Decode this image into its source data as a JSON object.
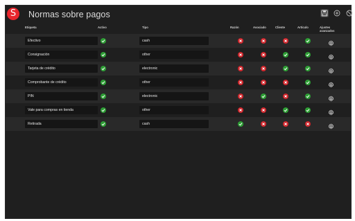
{
  "app": {
    "logo_letter": "S",
    "title": "Normas sobre pagos"
  },
  "toolbar": {
    "icons": [
      "save-icon",
      "add-icon",
      "block-icon"
    ]
  },
  "columns": {
    "label": "Etiqueta",
    "active": "Activo",
    "type": "Tipo",
    "reason": "Razón",
    "associated": "Asociado",
    "customer": "Cliente",
    "item": "Artículo",
    "advanced_1": "Ajustes",
    "advanced_2": "avanzados"
  },
  "rows": [
    {
      "label": "Efectivo",
      "active": true,
      "type": "cash",
      "reason": false,
      "associated": false,
      "customer": false,
      "item": true
    },
    {
      "label": "Consignación",
      "active": true,
      "type": "other",
      "reason": false,
      "associated": false,
      "customer": true,
      "item": true
    },
    {
      "label": "Tarjeta de crédito",
      "active": true,
      "type": "electronic",
      "reason": false,
      "associated": false,
      "customer": true,
      "item": true
    },
    {
      "label": "Comprobante de crédito",
      "active": true,
      "type": "other",
      "reason": false,
      "associated": false,
      "customer": false,
      "item": true
    },
    {
      "label": "PIN",
      "active": true,
      "type": "electronic",
      "reason": false,
      "associated": true,
      "customer": false,
      "item": true
    },
    {
      "label": "Vale para compras en tienda",
      "active": true,
      "type": "other",
      "reason": false,
      "associated": false,
      "customer": true,
      "item": true
    },
    {
      "label": "Retirada",
      "active": true,
      "type": "cash",
      "reason": true,
      "associated": false,
      "customer": false,
      "item": false
    }
  ],
  "colors": {
    "accent": "#e8262d",
    "on": "#2e9e35",
    "off": "#d0262c",
    "background": "#1f1f1f"
  }
}
